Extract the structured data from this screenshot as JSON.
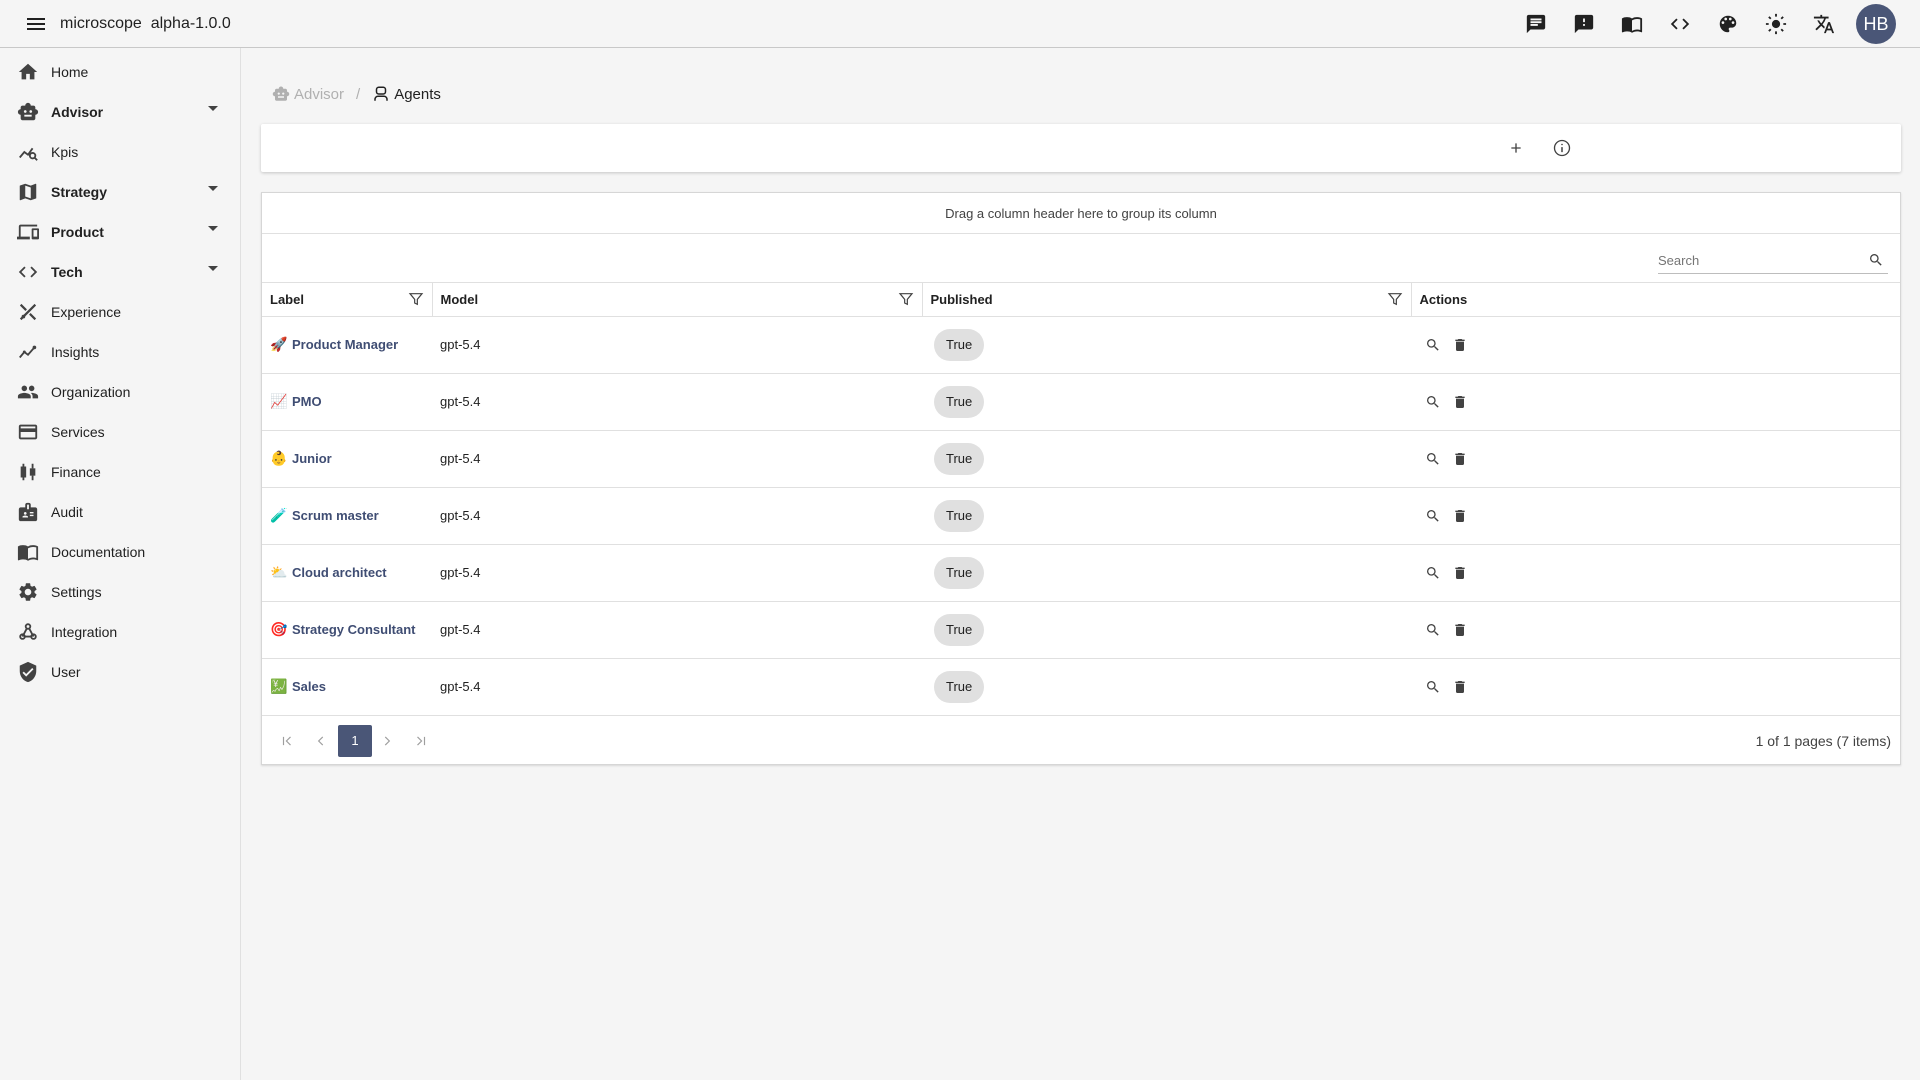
{
  "app": {
    "name": "microscope",
    "version": "alpha-1.0.0"
  },
  "topbar": {
    "icons": [
      "chat-icon",
      "feedback-icon",
      "book-icon",
      "code-icon",
      "palette-icon",
      "brightness-icon",
      "translate-icon"
    ],
    "avatar_initials": "HB"
  },
  "sidebar": {
    "items": [
      {
        "label": "Home",
        "icon": "home-icon",
        "group": false
      },
      {
        "label": "Advisor",
        "icon": "robot-icon",
        "group": true
      },
      {
        "label": "Kpis",
        "icon": "query-stats-icon",
        "group": false
      },
      {
        "label": "Strategy",
        "icon": "map-icon",
        "group": true
      },
      {
        "label": "Product",
        "icon": "devices-icon",
        "group": true
      },
      {
        "label": "Tech",
        "icon": "code-icon",
        "group": true
      },
      {
        "label": "Experience",
        "icon": "design-icon",
        "group": false
      },
      {
        "label": "Insights",
        "icon": "insights-icon",
        "group": false
      },
      {
        "label": "Organization",
        "icon": "people-icon",
        "group": false
      },
      {
        "label": "Services",
        "icon": "card-icon",
        "group": false
      },
      {
        "label": "Finance",
        "icon": "candlestick-icon",
        "group": false
      },
      {
        "label": "Audit",
        "icon": "badge-icon",
        "group": false
      },
      {
        "label": "Documentation",
        "icon": "book-icon",
        "group": false
      },
      {
        "label": "Settings",
        "icon": "gear-icon",
        "group": false
      },
      {
        "label": "Integration",
        "icon": "webhook-icon",
        "group": false
      },
      {
        "label": "User",
        "icon": "shield-icon",
        "group": false
      }
    ]
  },
  "breadcrumb": {
    "parent": "Advisor",
    "current": "Agents"
  },
  "grid": {
    "group_panel_text": "Drag a column header here to group its column",
    "search_placeholder": "Search",
    "columns": {
      "label": "Label",
      "model": "Model",
      "published": "Published",
      "actions": "Actions"
    },
    "rows": [
      {
        "emoji": "🚀",
        "label": "Product Manager",
        "model": "gpt-5.4",
        "published": "True"
      },
      {
        "emoji": "📈",
        "label": "PMO",
        "model": "gpt-5.4",
        "published": "True"
      },
      {
        "emoji": "👶",
        "label": "Junior",
        "model": "gpt-5.4",
        "published": "True"
      },
      {
        "emoji": "🧪",
        "label": "Scrum master",
        "model": "gpt-5.4",
        "published": "True"
      },
      {
        "emoji": "⛅",
        "label": "Cloud architect",
        "model": "gpt-5.4",
        "published": "True"
      },
      {
        "emoji": "🎯",
        "label": "Strategy Consultant",
        "model": "gpt-5.4",
        "published": "True"
      },
      {
        "emoji": "💹",
        "label": "Sales",
        "model": "gpt-5.4",
        "published": "True"
      }
    ],
    "pager": {
      "current_page": "1",
      "info": "1 of 1 pages (7 items)"
    }
  },
  "colors": {
    "accent": "#4a5677",
    "link": "#3f4d73",
    "chip": "#e0e0e0",
    "background": "#f5f5f5"
  }
}
